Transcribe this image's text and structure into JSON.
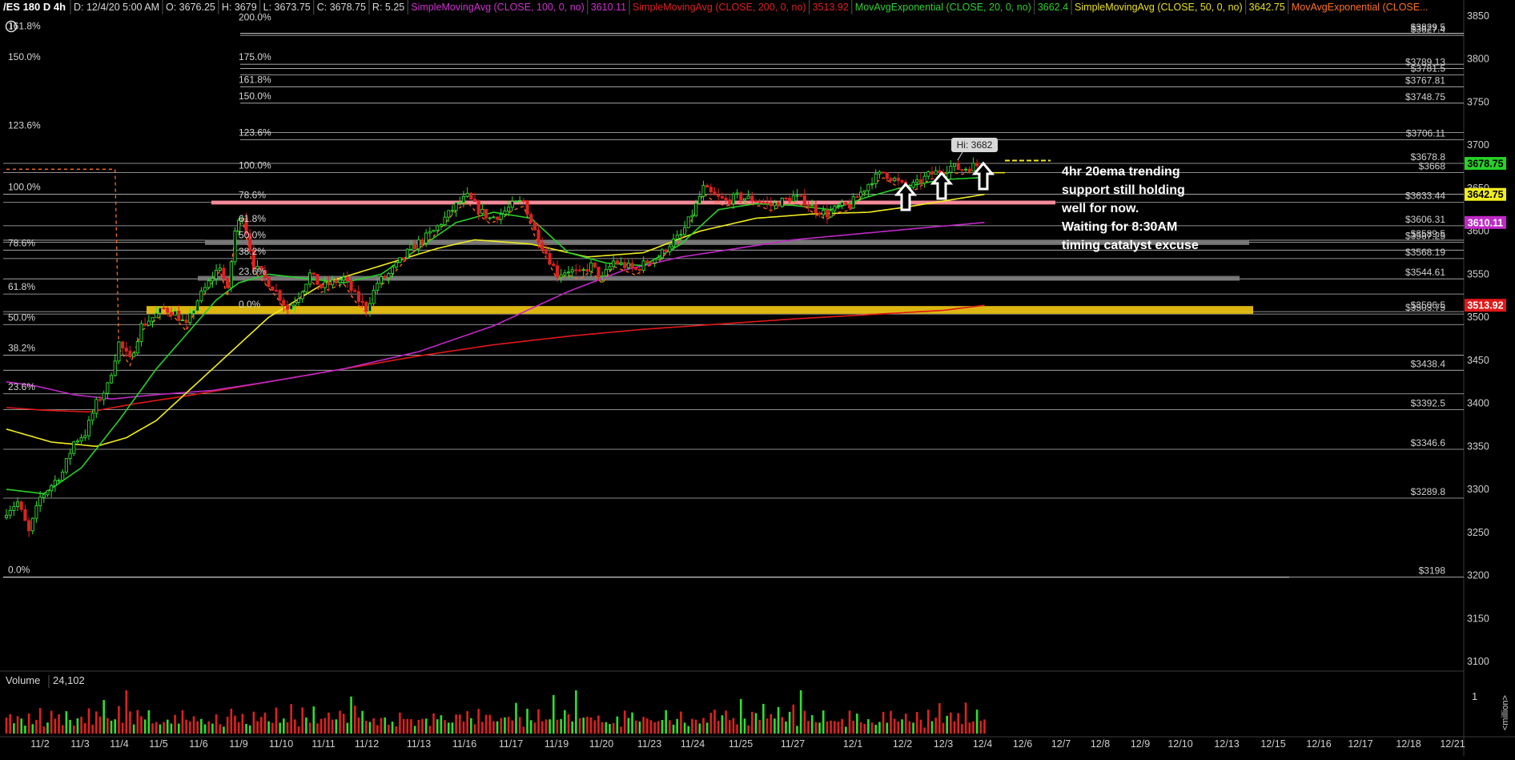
{
  "header": {
    "symbol": "/ES 180 D 4h",
    "fields": [
      {
        "text": "D: 12/4/20 5:00 AM",
        "color": "#d8d8d8"
      },
      {
        "text": "O: 3676.25",
        "color": "#d8d8d8"
      },
      {
        "text": "H: 3679",
        "color": "#d8d8d8"
      },
      {
        "text": "L: 3673.75",
        "color": "#d8d8d8"
      },
      {
        "text": "C: 3678.75",
        "color": "#d8d8d8"
      },
      {
        "text": "R: 5.25",
        "color": "#d8d8d8"
      },
      {
        "text": "SimpleMovingAvg (CLOSE, 100, 0, no)",
        "color": "#d030d0"
      },
      {
        "text": "3610.11",
        "color": "#d030d0"
      },
      {
        "text": "SimpleMovingAvg (CLOSE, 200, 0, no)",
        "color": "#e02020"
      },
      {
        "text": "3513.92",
        "color": "#e02020"
      },
      {
        "text": "MovAvgExponential (CLOSE, 20, 0, no)",
        "color": "#30d030"
      },
      {
        "text": "3662.4",
        "color": "#30d030"
      },
      {
        "text": "SimpleMovingAvg (CLOSE, 50, 0, no)",
        "color": "#e8e020"
      },
      {
        "text": "3642.75",
        "color": "#e8e020"
      },
      {
        "text": "MovAvgExponential (CLOSE...",
        "color": "#ff7020"
      }
    ]
  },
  "annotation": {
    "lines": [
      "4hr 20ema trending",
      "support still holding",
      "well for now.",
      "Waiting for 8:30AM",
      "timing catalyst excuse"
    ]
  },
  "hi_label": "Hi: 3682",
  "volume": {
    "label": "Volume",
    "value": "24,102",
    "axis_labels": [
      "1",
      "<million>"
    ]
  },
  "colors": {
    "up": "#2ee02e",
    "down": "#e02020",
    "sma100": "#c028c8",
    "sma200": "#e01818",
    "ema20": "#28d028",
    "sma50": "#f0ec20",
    "ema_dash": "#ff7020",
    "pink_zone": "#ff8fa0",
    "grey_zone": "#808080",
    "yellow_zone": "#e8c010"
  },
  "chart_data": {
    "type": "candlestick",
    "y_axis": {
      "min": 3070,
      "max": 3870,
      "ticks": [
        "3850",
        "3800",
        "3750",
        "3700",
        "3650",
        "3600",
        "3550",
        "3500",
        "3450",
        "3400",
        "3350",
        "3300",
        "3250",
        "3200",
        "3150",
        "3100"
      ]
    },
    "x_axis": {
      "ticks": [
        "11/2",
        "11/3",
        "11/4",
        "11/5",
        "11/6",
        "11/9",
        "11/10",
        "11/11",
        "11/12",
        "11/13",
        "11/16",
        "11/17",
        "11/19",
        "11/20",
        "11/23",
        "11/24",
        "11/25",
        "11/27",
        "12/1",
        "12/2",
        "12/3",
        "12/4",
        "12/6",
        "12/7",
        "12/8",
        "12/9",
        "12/10",
        "12/13",
        "12/15",
        "12/16",
        "12/17",
        "12/18",
        "12/21"
      ]
    },
    "price_badges": [
      {
        "value": "3678.75",
        "price": 3678.75,
        "bg": "#28d028",
        "fg": "#000000"
      },
      {
        "value": "3642.75",
        "price": 3642.75,
        "bg": "#f0ec20",
        "fg": "#000000"
      },
      {
        "value": "3610.11",
        "price": 3610.11,
        "bg": "#c028c8",
        "fg": "#ffffff"
      },
      {
        "value": "3513.92",
        "price": 3513.92,
        "bg": "#e01818",
        "fg": "#ffffff"
      }
    ],
    "fib_left": [
      {
        "label": "161.8%",
        "price": 3830.0
      },
      {
        "label": "150.0%",
        "price": 3794.0
      },
      {
        "label": "123.6%",
        "price": 3714.5
      },
      {
        "label": "100.0%",
        "price": 3643.0
      },
      {
        "label": "78.6%",
        "price": 3578.0
      },
      {
        "label": "61.8%",
        "price": 3527.0
      },
      {
        "label": "50.0%",
        "price": 3491.5
      },
      {
        "label": "38.2%",
        "price": 3456.0
      },
      {
        "label": "23.6%",
        "price": 3411.0
      },
      {
        "label": "0.0%",
        "price": 3198.0
      }
    ],
    "fib_mid": [
      {
        "label": "200.0%",
        "price": 3840.0
      },
      {
        "label": "175.0%",
        "price": 3794.0
      },
      {
        "label": "161.8%",
        "price": 3767.81
      },
      {
        "label": "150.0%",
        "price": 3748.75
      },
      {
        "label": "123.6%",
        "price": 3706.11
      },
      {
        "label": "100.0%",
        "price": 3668.0
      },
      {
        "label": "78.6%",
        "price": 3633.44
      },
      {
        "label": "61.8%",
        "price": 3606.31
      },
      {
        "label": "50.0%",
        "price": 3587.25
      },
      {
        "label": "38.2%",
        "price": 3568.19
      },
      {
        "label": "23.6%",
        "price": 3544.61
      },
      {
        "label": "0.0%",
        "price": 3506.5
      }
    ],
    "level_labels": [
      {
        "text": "$3829.5",
        "price": 3829.5
      },
      {
        "text": "$3827.4",
        "price": 3827.4
      },
      {
        "text": "$3789.13",
        "price": 3789.13
      },
      {
        "text": "$3781.5",
        "price": 3781.5
      },
      {
        "text": "$3767.81",
        "price": 3767.81
      },
      {
        "text": "$3748.75",
        "price": 3748.75
      },
      {
        "text": "$3706.11",
        "price": 3706.11
      },
      {
        "text": "$3678.8",
        "price": 3678.8
      },
      {
        "text": "$3668",
        "price": 3668.0
      },
      {
        "text": "$3633.44",
        "price": 3633.44
      },
      {
        "text": "$3606.31",
        "price": 3606.31
      },
      {
        "text": "$3589.5",
        "price": 3589.5
      },
      {
        "text": "$3587.25",
        "price": 3587.25
      },
      {
        "text": "$3568.19",
        "price": 3568.19
      },
      {
        "text": "$3544.61",
        "price": 3544.61
      },
      {
        "text": "$3506.5",
        "price": 3506.5
      },
      {
        "text": "$3503.75",
        "price": 3503.75
      },
      {
        "text": "$3438.4",
        "price": 3438.4
      },
      {
        "text": "$3392.5",
        "price": 3392.5
      },
      {
        "text": "$3346.6",
        "price": 3346.6
      },
      {
        "text": "$3289.8",
        "price": 3289.8
      },
      {
        "text": "$3198",
        "price": 3198.0
      }
    ],
    "zones": [
      {
        "name": "pink",
        "top": 3635.5,
        "bottom": 3631.0
      },
      {
        "name": "grey",
        "top": 3590.0,
        "bottom": 3584.0
      },
      {
        "name": "grey",
        "top": 3548.0,
        "bottom": 3542.5
      },
      {
        "name": "yellow",
        "top": 3513.0,
        "bottom": 3504.0
      }
    ],
    "close_anchors": [
      [
        0,
        3275
      ],
      [
        3,
        3285
      ],
      [
        6,
        3250
      ],
      [
        9,
        3290
      ],
      [
        12,
        3305
      ],
      [
        15,
        3320
      ],
      [
        18,
        3355
      ],
      [
        21,
        3365
      ],
      [
        24,
        3400
      ],
      [
        27,
        3420
      ],
      [
        30,
        3470
      ],
      [
        33,
        3450
      ],
      [
        36,
        3490
      ],
      [
        39,
        3500
      ],
      [
        42,
        3510
      ],
      [
        45,
        3505
      ],
      [
        48,
        3490
      ],
      [
        51,
        3520
      ],
      [
        54,
        3540
      ],
      [
        57,
        3560
      ],
      [
        59,
        3530
      ],
      [
        61,
        3600
      ],
      [
        63,
        3620
      ],
      [
        66,
        3560
      ],
      [
        69,
        3545
      ],
      [
        72,
        3530
      ],
      [
        75,
        3510
      ],
      [
        78,
        3525
      ],
      [
        81,
        3550
      ],
      [
        84,
        3535
      ],
      [
        87,
        3540
      ],
      [
        90,
        3545
      ],
      [
        93,
        3525
      ],
      [
        96,
        3510
      ],
      [
        99,
        3540
      ],
      [
        102,
        3550
      ],
      [
        105,
        3565
      ],
      [
        108,
        3580
      ],
      [
        111,
        3590
      ],
      [
        114,
        3600
      ],
      [
        117,
        3615
      ],
      [
        120,
        3630
      ],
      [
        123,
        3640
      ],
      [
        126,
        3625
      ],
      [
        129,
        3615
      ],
      [
        132,
        3620
      ],
      [
        135,
        3630
      ],
      [
        138,
        3635
      ],
      [
        141,
        3600
      ],
      [
        144,
        3575
      ],
      [
        147,
        3550
      ],
      [
        150,
        3555
      ],
      [
        153,
        3550
      ],
      [
        156,
        3560
      ],
      [
        159,
        3545
      ],
      [
        162,
        3565
      ],
      [
        165,
        3560
      ],
      [
        168,
        3555
      ],
      [
        171,
        3565
      ],
      [
        174,
        3570
      ],
      [
        177,
        3585
      ],
      [
        180,
        3595
      ],
      [
        183,
        3620
      ],
      [
        186,
        3650
      ],
      [
        189,
        3640
      ],
      [
        192,
        3635
      ],
      [
        195,
        3640
      ],
      [
        198,
        3638
      ],
      [
        201,
        3635
      ],
      [
        204,
        3630
      ],
      [
        207,
        3635
      ],
      [
        210,
        3640
      ],
      [
        213,
        3635
      ],
      [
        216,
        3625
      ],
      [
        219,
        3620
      ],
      [
        222,
        3628
      ],
      [
        225,
        3630
      ],
      [
        228,
        3645
      ],
      [
        231,
        3660
      ],
      [
        234,
        3668
      ],
      [
        237,
        3660
      ],
      [
        240,
        3650
      ],
      [
        243,
        3655
      ],
      [
        246,
        3665
      ],
      [
        249,
        3670
      ],
      [
        252,
        3675
      ],
      [
        255,
        3672
      ],
      [
        258,
        3676
      ],
      [
        261,
        3678
      ]
    ],
    "ma_anchors": {
      "sma200": [
        [
          0,
          3395
        ],
        [
          10,
          3392
        ],
        [
          22,
          3390
        ],
        [
          35,
          3400
        ],
        [
          50,
          3410
        ],
        [
          70,
          3425
        ],
        [
          90,
          3440
        ],
        [
          110,
          3455
        ],
        [
          130,
          3468
        ],
        [
          150,
          3478
        ],
        [
          170,
          3486
        ],
        [
          190,
          3492
        ],
        [
          210,
          3498
        ],
        [
          230,
          3503
        ],
        [
          250,
          3508
        ],
        [
          261,
          3513.92
        ]
      ],
      "sma100": [
        [
          0,
          3425
        ],
        [
          8,
          3420
        ],
        [
          18,
          3410
        ],
        [
          28,
          3405
        ],
        [
          40,
          3410
        ],
        [
          55,
          3415
        ],
        [
          70,
          3425
        ],
        [
          90,
          3440
        ],
        [
          110,
          3460
        ],
        [
          130,
          3490
        ],
        [
          150,
          3530
        ],
        [
          165,
          3555
        ],
        [
          180,
          3570
        ],
        [
          195,
          3580
        ],
        [
          210,
          3590
        ],
        [
          230,
          3598
        ],
        [
          245,
          3604
        ],
        [
          261,
          3610.11
        ]
      ],
      "sma50": [
        [
          0,
          3370
        ],
        [
          12,
          3355
        ],
        [
          24,
          3350
        ],
        [
          32,
          3360
        ],
        [
          40,
          3380
        ],
        [
          50,
          3420
        ],
        [
          60,
          3460
        ],
        [
          70,
          3500
        ],
        [
          85,
          3540
        ],
        [
          100,
          3560
        ],
        [
          115,
          3580
        ],
        [
          125,
          3590
        ],
        [
          140,
          3585
        ],
        [
          155,
          3570
        ],
        [
          170,
          3575
        ],
        [
          185,
          3600
        ],
        [
          200,
          3615
        ],
        [
          215,
          3620
        ],
        [
          230,
          3622
        ],
        [
          240,
          3628
        ],
        [
          250,
          3635
        ],
        [
          261,
          3642.75
        ]
      ],
      "ema20": [
        [
          0,
          3300
        ],
        [
          10,
          3295
        ],
        [
          20,
          3325
        ],
        [
          30,
          3380
        ],
        [
          40,
          3440
        ],
        [
          50,
          3490
        ],
        [
          56,
          3520
        ],
        [
          62,
          3540
        ],
        [
          70,
          3550
        ],
        [
          80,
          3545
        ],
        [
          90,
          3540
        ],
        [
          100,
          3550
        ],
        [
          110,
          3580
        ],
        [
          120,
          3610
        ],
        [
          130,
          3622
        ],
        [
          140,
          3615
        ],
        [
          150,
          3575
        ],
        [
          160,
          3563
        ],
        [
          170,
          3560
        ],
        [
          180,
          3585
        ],
        [
          190,
          3625
        ],
        [
          200,
          3632
        ],
        [
          210,
          3630
        ],
        [
          220,
          3625
        ],
        [
          230,
          3640
        ],
        [
          240,
          3652
        ],
        [
          250,
          3660
        ],
        [
          261,
          3662.4
        ]
      ]
    },
    "volume_values": [
      0.6,
      0.45,
      0.3,
      0.55,
      0.4,
      0.25,
      0.65,
      0.35,
      0.5,
      0.7,
      0.3,
      0.45,
      0.6,
      0.4,
      0.55,
      0.35,
      0.8,
      0.45,
      0.3,
      0.65,
      0.5,
      0.4,
      0.75,
      0.35,
      0.6,
      0.45,
      0.9,
      0.5,
      0.4,
      0.55,
      0.7,
      0.3,
      1.1,
      0.65,
      0.4,
      0.55,
      0.45,
      0.35,
      0.6,
      0.3,
      0.5,
      0.4,
      0.35,
      0.45,
      0.3,
      0.55,
      0.4,
      0.6,
      0.35,
      0.3,
      0.45,
      0.4,
      0.35,
      0.3,
      0.5,
      0.4,
      0.55,
      0.35,
      0.3,
      0.45
    ]
  }
}
